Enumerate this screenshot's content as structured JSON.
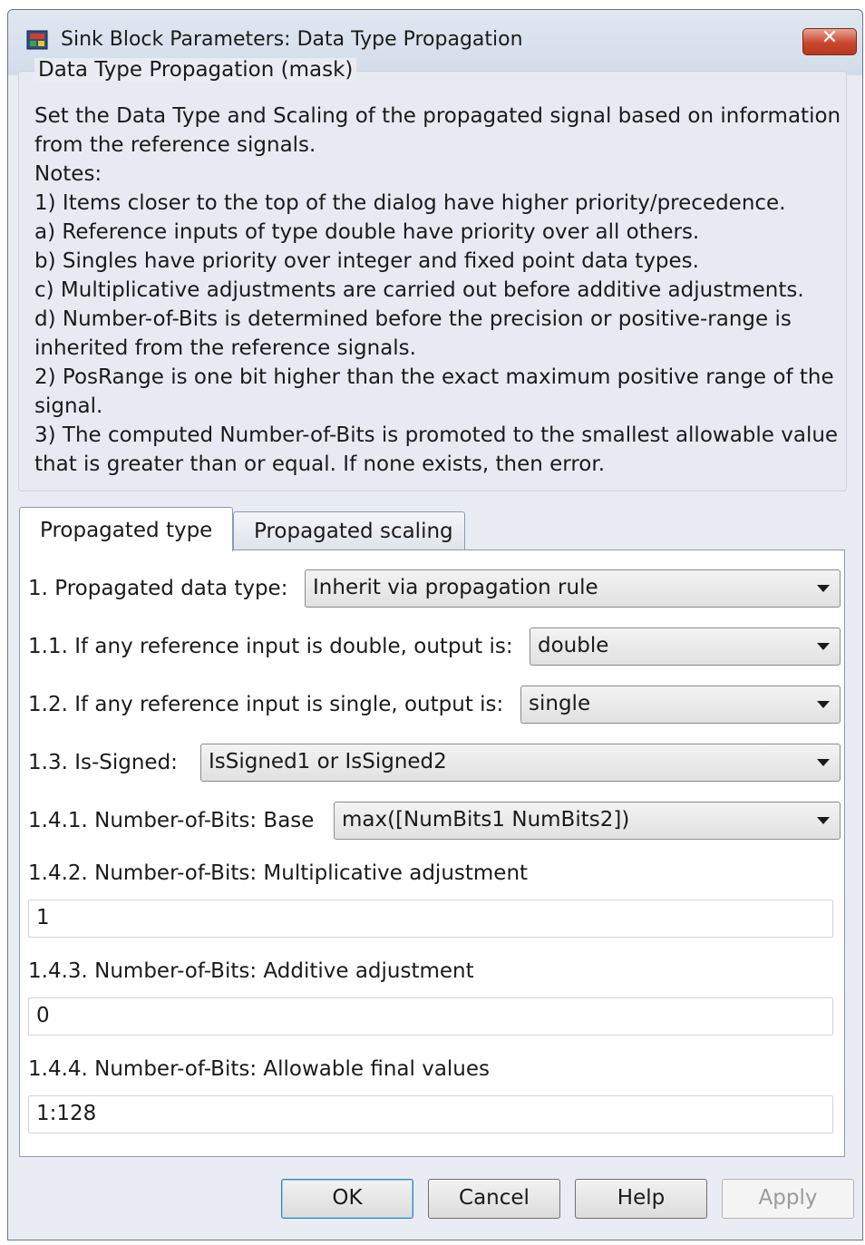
{
  "window": {
    "title": "Sink Block Parameters: Data Type Propagation",
    "close_label": "✕"
  },
  "mask_group": {
    "legend": "Data Type Propagation (mask)",
    "description_lines": [
      "Set the Data Type and Scaling of the propagated signal based on information",
      "from the reference signals.",
      "Notes:",
      "1) Items closer to the top of the dialog have higher priority/precedence.",
      "a) Reference inputs of type double have priority over all others.",
      "b) Singles have priority over integer and fixed point data types.",
      "c) Multiplicative adjustments are carried out before additive adjustments.",
      "d) Number-of-Bits is determined before the precision or positive-range is",
      "inherited from the reference signals.",
      "2) PosRange is one bit higher than the exact maximum positive range of the",
      "signal.",
      "3) The computed Number-of-Bits is promoted to the smallest allowable value",
      "that is greater than or equal.  If none exists, then error."
    ]
  },
  "tabs": [
    {
      "label": "Propagated type",
      "active": true
    },
    {
      "label": "Propagated scaling",
      "active": false
    }
  ],
  "params": {
    "propagated_data_type": {
      "label": "1. Propagated data type:",
      "value": "Inherit via propagation rule"
    },
    "if_double": {
      "label": "1.1. If any reference input is double, output is:",
      "value": "double"
    },
    "if_single": {
      "label": "1.2. If any reference input is single, output is:",
      "value": "single"
    },
    "is_signed": {
      "label": "1.3. Is-Signed:",
      "value": "IsSigned1 or IsSigned2"
    },
    "numbits_base": {
      "label": "1.4.1. Number-of-Bits: Base",
      "value": "max([NumBits1 NumBits2])"
    },
    "numbits_mult": {
      "label": "1.4.2. Number-of-Bits: Multiplicative adjustment",
      "value": "1"
    },
    "numbits_add": {
      "label": "1.4.3. Number-of-Bits: Additive adjustment",
      "value": "0"
    },
    "numbits_allowable": {
      "label": "1.4.4. Number-of-Bits: Allowable final values",
      "value": "1:128"
    }
  },
  "buttons": {
    "ok": "OK",
    "cancel": "Cancel",
    "help": "Help",
    "apply": "Apply"
  },
  "colors": {
    "dialog_bg": "#e9ecf2",
    "close_button": "#c9472e",
    "ok_focus_border": "#3c7fb1"
  }
}
